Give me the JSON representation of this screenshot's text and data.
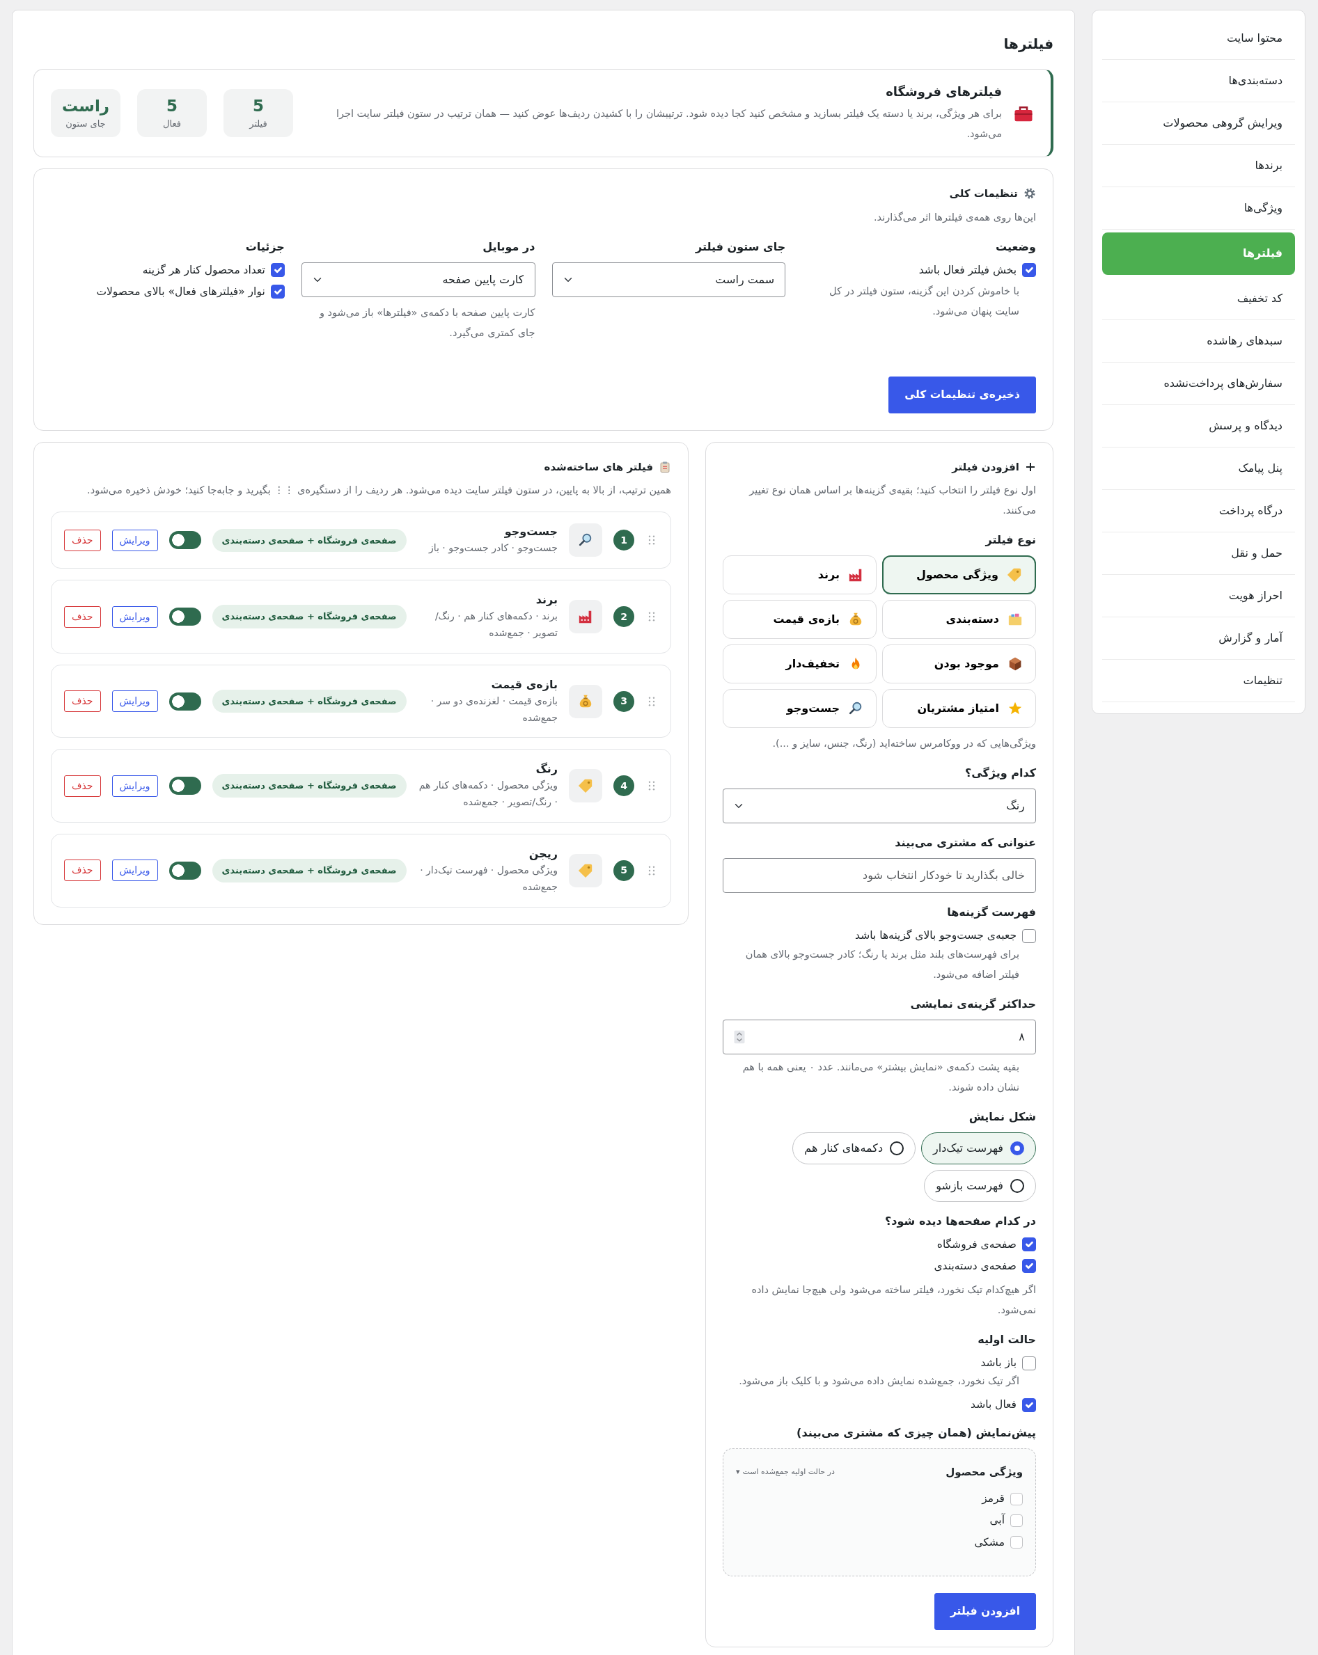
{
  "sidebar": {
    "items": [
      {
        "label": "محتوا سایت",
        "selected": false
      },
      {
        "label": "دسته‌بندی‌ها",
        "selected": false
      },
      {
        "label": "ویرایش گروهی محصولات",
        "selected": false
      },
      {
        "label": "برندها",
        "selected": false
      },
      {
        "label": "ویژگی‌ها",
        "selected": false
      },
      {
        "label": "فیلترها",
        "selected": true
      },
      {
        "label": "کد تخفیف",
        "selected": false
      },
      {
        "label": "سبدهای رهاشده",
        "selected": false
      },
      {
        "label": "سفارش‌های پرداخت‌نشده",
        "selected": false
      },
      {
        "label": "دیدگاه و پرسش",
        "selected": false
      },
      {
        "label": "پنل پیامک",
        "selected": false
      },
      {
        "label": "درگاه پرداخت",
        "selected": false
      },
      {
        "label": "حمل و نقل",
        "selected": false
      },
      {
        "label": "احراز هویت",
        "selected": false
      },
      {
        "label": "آمار و گزارش",
        "selected": false
      },
      {
        "label": "تنظیمات",
        "selected": false
      }
    ]
  },
  "page_title": "فیلترها",
  "header": {
    "title": "فیلترهای فروشگاه",
    "description": "برای هر ویژگی، برند یا دسته یک فیلتر بسازید و مشخص کنید کجا دیده شود. ترتیبشان را با کشیدن ردیف‌ها عوض کنید — همان ترتیب در ستون فیلتر سایت اجرا می‌شود.",
    "stats": [
      {
        "value": "5",
        "label": "فیلتر"
      },
      {
        "value": "5",
        "label": "فعال"
      },
      {
        "value": "راست",
        "label": "جای ستون"
      }
    ]
  },
  "general_settings": {
    "title": "تنظیمات کلی",
    "description": "این‌ها روی همه‌ی فیلترها اثر می‌گذارند.",
    "status": {
      "label": "وضعیت",
      "option": "بخش فیلتر فعال باشد",
      "checked": true,
      "help": "با خاموش کردن این گزینه، ستون فیلتر در کل سایت پنهان می‌شود."
    },
    "column_position": {
      "label": "جای ستون فیلتر",
      "value": "سمت راست"
    },
    "mobile": {
      "label": "در موبایل",
      "value": "کارت پایین صفحه",
      "help": "کارت پایین صفحه با دکمه‌ی «فیلترها» باز می‌شود و جای کمتری می‌گیرد."
    },
    "details": {
      "label": "جزئیات",
      "options": [
        {
          "label": "تعداد محصول کنار هر گزینه",
          "checked": true
        },
        {
          "label": "نوار «فیلترهای فعال» بالای محصولات",
          "checked": true
        }
      ]
    },
    "save_button": "ذخیره‌ی تنظیمات کلی"
  },
  "add_filter": {
    "title": "افزودن فیلتر",
    "description": "اول نوع فیلتر را انتخاب کنید؛ بقیه‌ی گزینه‌ها بر اساس همان نوع تغییر می‌کنند.",
    "type_label": "نوع فیلتر",
    "types": [
      {
        "kind": "attribute",
        "label": "ویژگی محصول",
        "selected": true
      },
      {
        "kind": "brand",
        "label": "برند",
        "selected": false
      },
      {
        "kind": "category",
        "label": "دسته‌بندی",
        "selected": false
      },
      {
        "kind": "price",
        "label": "بازه‌ی قیمت",
        "selected": false
      },
      {
        "kind": "stock",
        "label": "موجود بودن",
        "selected": false
      },
      {
        "kind": "sale",
        "label": "تخفیف‌دار",
        "selected": false
      },
      {
        "kind": "rating",
        "label": "امتیاز مشتریان",
        "selected": false
      },
      {
        "kind": "search",
        "label": "جست‌وجو",
        "selected": false
      }
    ],
    "type_help": "ویژگی‌هایی که در ووکامرس ساخته‌اید (رنگ، جنس، سایز و ...).",
    "attribute": {
      "label": "کدام ویژگی؟",
      "value": "رنگ"
    },
    "display_title": {
      "label": "عنوانی که مشتری می‌بیند",
      "placeholder": "خالی بگذارید تا خودکار انتخاب شود"
    },
    "options_list": {
      "label": "فهرست گزینه‌ها",
      "option": "جعبه‌ی جست‌وجو بالای گزینه‌ها باشد",
      "checked": false,
      "help": "برای فهرست‌های بلند مثل برند یا رنگ؛ کادر جست‌وجو بالای همان فیلتر اضافه می‌شود."
    },
    "max_options": {
      "label": "حداکثر گزینه‌ی نمایشی",
      "value": "۸",
      "help": "بقیه پشت دکمه‌ی «نمایش بیشتر» می‌مانند. عدد ۰ یعنی همه با هم نشان داده شوند."
    },
    "display_style": {
      "label": "شکل نمایش",
      "options": [
        {
          "label": "فهرست تیک‌دار",
          "selected": true
        },
        {
          "label": "دکمه‌های کنار هم",
          "selected": false
        },
        {
          "label": "فهرست بازشو",
          "selected": false
        }
      ]
    },
    "pages": {
      "label": "در کدام صفحه‌ها دیده شود؟",
      "options": [
        {
          "label": "صفحه‌ی فروشگاه",
          "checked": true
        },
        {
          "label": "صفحه‌ی دسته‌بندی",
          "checked": true
        }
      ],
      "help": "اگر هیچ‌کدام تیک نخورد، فیلتر ساخته می‌شود ولی هیچ‌جا نمایش داده نمی‌شود."
    },
    "initial_state": {
      "label": "حالت اولیه",
      "options": [
        {
          "label": "باز باشد",
          "checked": false,
          "help": "اگر تیک نخورد، جمع‌شده نمایش داده می‌شود و با کلیک باز می‌شود."
        },
        {
          "label": "فعال باشد",
          "checked": true
        }
      ]
    },
    "preview": {
      "label": "پیش‌نمایش (همان چیزی که مشتری می‌بیند)",
      "title": "ویژگی محصول",
      "note": "در حالت اولیه جمع‌شده است",
      "caret": "▾",
      "options": [
        {
          "label": "قرمز",
          "checked": false
        },
        {
          "label": "آبی",
          "checked": false
        },
        {
          "label": "مشکی",
          "checked": false
        }
      ]
    },
    "submit_button": "افزودن فیلتر"
  },
  "filters": {
    "title": "فیلتر های ساخته‌شده",
    "description": "همین ترتیب، از بالا به پایین، در ستون فیلتر سایت دیده می‌شود. هر ردیف را از دستگیره‌ی ⋮⋮ بگیرید و جابه‌جا کنید؛ خودش ذخیره می‌شود.",
    "items": [
      {
        "number": "1",
        "kind": "search",
        "name": "جست‌وجو",
        "meta": "جست‌وجو · کادر جست‌وجو · باز",
        "pages": "صفحه‌ی فروشگاه + صفحه‌ی دسته‌بندی",
        "enabled": true,
        "edit": "ویرایش",
        "delete": "حذف"
      },
      {
        "number": "2",
        "kind": "brand",
        "name": "برند",
        "meta": "برند · دکمه‌های کنار هم · رنگ/تصویر · جمع‌شده",
        "pages": "صفحه‌ی فروشگاه + صفحه‌ی دسته‌بندی",
        "enabled": true,
        "edit": "ویرایش",
        "delete": "حذف"
      },
      {
        "number": "3",
        "kind": "price",
        "name": "بازه‌ی قیمت",
        "meta": "بازه‌ی قیمت · لغزنده‌ی دو سر · جمع‌شده",
        "pages": "صفحه‌ی فروشگاه + صفحه‌ی دسته‌بندی",
        "enabled": true,
        "edit": "ویرایش",
        "delete": "حذف"
      },
      {
        "number": "4",
        "kind": "attribute",
        "name": "رنگ",
        "meta": "ویژگی محصول · دکمه‌های کنار هم · رنگ/تصویر · جمع‌شده",
        "pages": "صفحه‌ی فروشگاه + صفحه‌ی دسته‌بندی",
        "enabled": true,
        "edit": "ویرایش",
        "delete": "حذف"
      },
      {
        "number": "5",
        "kind": "attribute",
        "name": "ریجن",
        "meta": "ویژگی محصول · فهرست تیک‌دار · جمع‌شده",
        "pages": "صفحه‌ی فروشگاه + صفحه‌ی دسته‌بندی",
        "enabled": true,
        "edit": "ویرایش",
        "delete": "حذف"
      }
    ]
  }
}
